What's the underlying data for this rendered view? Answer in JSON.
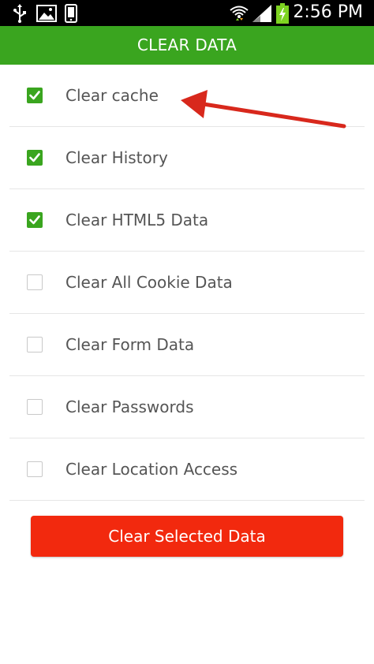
{
  "status_bar": {
    "time": "2:56 PM",
    "icons": [
      "usb-icon",
      "image-icon",
      "phone-icon",
      "wifi-icon",
      "signal-icon",
      "battery-charging-icon"
    ]
  },
  "header": {
    "title": "CLEAR DATA"
  },
  "options": [
    {
      "label": "Clear cache",
      "checked": true
    },
    {
      "label": "Clear History",
      "checked": true
    },
    {
      "label": "Clear HTML5 Data",
      "checked": true
    },
    {
      "label": "Clear All Cookie Data",
      "checked": false
    },
    {
      "label": "Clear Form Data",
      "checked": false
    },
    {
      "label": "Clear Passwords",
      "checked": false
    },
    {
      "label": "Clear Location Access",
      "checked": false
    }
  ],
  "action": {
    "button_label": "Clear Selected Data"
  },
  "colors": {
    "header": "#3aa51f",
    "checkbox_checked": "#3aa51f",
    "button": "#f2290e",
    "annotation_arrow": "#d8281c"
  }
}
